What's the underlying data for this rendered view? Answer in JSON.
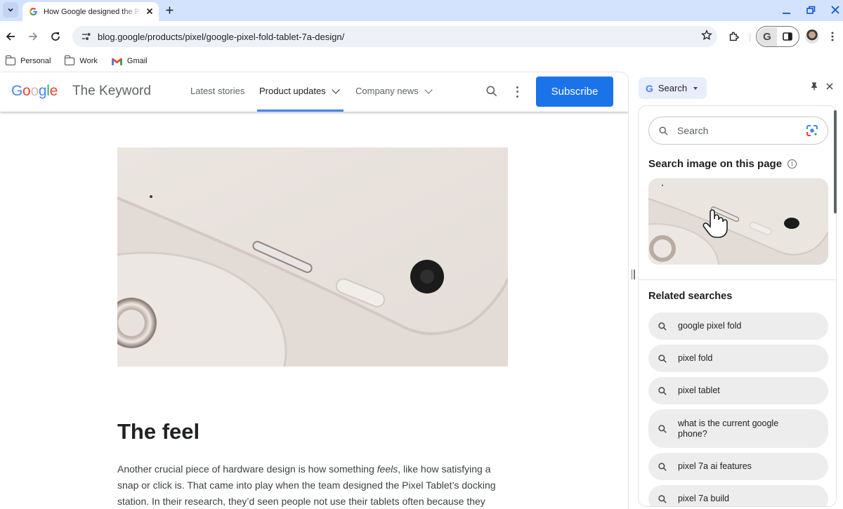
{
  "browser": {
    "tab": {
      "title": "How Google designed the P",
      "favicon": "google-g-icon"
    },
    "url": "blog.google/products/pixel/google-pixel-fold-tablet-7a-design/",
    "bookmarks": [
      {
        "label": "Personal",
        "icon": "folder-icon"
      },
      {
        "label": "Work",
        "icon": "folder-icon"
      },
      {
        "label": "Gmail",
        "icon": "gmail-icon"
      }
    ],
    "colors": {
      "tabstrip": "#d3e3fd",
      "window_controls": "#0b57d0"
    }
  },
  "site": {
    "logo": {
      "g1": "G",
      "o1": "o",
      "o2": "o",
      "g2": "g",
      "l": "l",
      "e": "e"
    },
    "brand": "The Keyword",
    "nav": [
      {
        "label": "Latest stories",
        "has_dropdown": false,
        "active": false
      },
      {
        "label": "Product updates",
        "has_dropdown": true,
        "active": true
      },
      {
        "label": "Company news",
        "has_dropdown": true,
        "active": false
      }
    ],
    "subscribe_label": "Subscribe",
    "accent": "#1a73e8"
  },
  "article": {
    "hero_alt": "Close-up of a Pixel Tablet edge with volume button, speaker and camera next to the docking station",
    "heading": "The feel",
    "body_pre": "Another crucial piece of hardware design is how something ",
    "body_em": "feels",
    "body_post": ", like how satisfying a snap or click is. That came into play when the team designed the Pixel Tablet’s docking station. In their research, they’d seen people not use their tablets often because they"
  },
  "side_panel": {
    "selector_label": "Search",
    "search_placeholder": "Search",
    "image_section_title": "Search image on this page",
    "related_title": "Related searches",
    "related": [
      "google pixel fold",
      "pixel fold",
      "pixel tablet",
      "what is the current google phone?",
      "pixel 7a ai features",
      "pixel 7a build"
    ]
  }
}
